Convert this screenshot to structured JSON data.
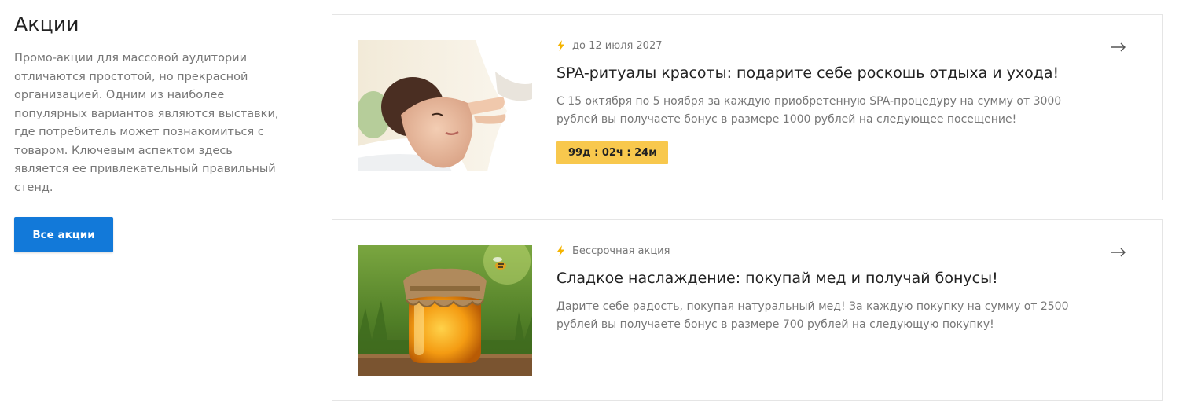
{
  "section": {
    "title": "Акции",
    "description": "Промо-акции для массовой аудитории отличаются простотой, но прекрасной организацией. Одним из наиболее популярных вариантов являются выставки, где потребитель может познакомиться с товаром. Ключевым аспектом здесь является ее привлекательный правильный стенд.",
    "all_button": "Все акции"
  },
  "colors": {
    "accent": "#1279d9",
    "timer_bg": "#f8c84d",
    "bolt": "#f5b400"
  },
  "promos": [
    {
      "meta_icon": "lightning-icon",
      "meta": "до 12 июля 2027",
      "title": "SPA-ритуалы красоты: подарите себе роскошь отдыха и ухода!",
      "description": "С 15 октября по 5 ноября за каждую приобретенную SPA-процедуру на сумму от 3000 рублей вы получаете бонус в размере 1000 рублей на следующее посещение!",
      "timer": "99д : 02ч : 24м",
      "image": "spa-massage-photo",
      "arrow_icon": "arrow-right-icon"
    },
    {
      "meta_icon": "lightning-icon",
      "meta": "Бессрочная акция",
      "title": "Сладкое наслаждение: покупай мед и получай бонусы!",
      "description": "Дарите себе радость, покупая натуральный мед! За каждую покупку на сумму от 2500 рублей вы получаете бонус в размере 700 рублей на следующую покупку!",
      "image": "honey-jar-photo",
      "arrow_icon": "arrow-right-icon"
    }
  ]
}
